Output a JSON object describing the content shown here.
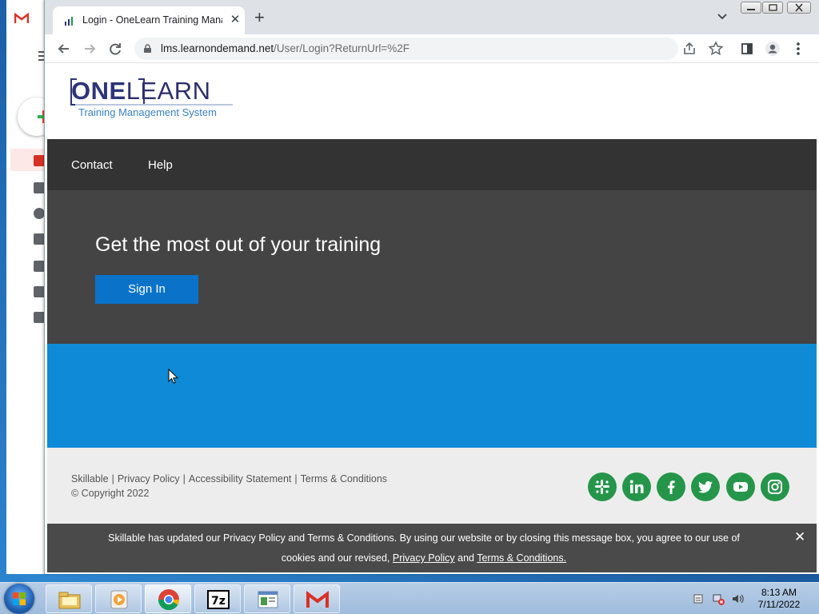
{
  "browser": {
    "tab_title": "Login - OneLearn Training Manag",
    "tab_close": "✕",
    "new_tab": "+",
    "url_host": "lms.learnondemand.net",
    "url_path": "/User/Login?ReturnUrl=%2F"
  },
  "logo": {
    "word_bold": "ONE",
    "word_light": "LEARN",
    "tagline": "Training Management System"
  },
  "nav": {
    "items": [
      "Contact",
      "Help"
    ]
  },
  "hero": {
    "headline": "Get the most out of your training",
    "sign_in_label": "Sign In"
  },
  "footer": {
    "links": [
      "Skillable",
      "Privacy Policy",
      "Accessibility Statement",
      "Terms & Conditions"
    ],
    "separator": "|",
    "copyright": "© Copyright 2022",
    "social": [
      "slack-icon",
      "linkedin-icon",
      "facebook-icon",
      "twitter-icon",
      "youtube-icon",
      "instagram-icon"
    ],
    "social_color": "#25954a"
  },
  "cookie_banner": {
    "line1": "Skillable has updated our Privacy Policy and Terms & Conditions. By using our website or by closing this message box, you agree to our use of",
    "line2_prefix": "cookies and our revised, ",
    "privacy_link": "Privacy Policy",
    "line2_and": " and ",
    "terms_link": "Terms & Conditions.",
    "close": "✕"
  },
  "colors": {
    "navbar": "#333333",
    "hero": "#444444",
    "button": "#0a73c9",
    "band": "#0f8ad6",
    "footer": "#ededed",
    "cookie": "#4a4a4a"
  },
  "taskbar": {
    "apps": [
      "file-explorer-icon",
      "media-player-icon",
      "chrome-icon",
      "7zip-icon",
      "app-window-icon",
      "gmail-icon"
    ],
    "time": "8:13 AM",
    "date": "7/11/2022"
  }
}
